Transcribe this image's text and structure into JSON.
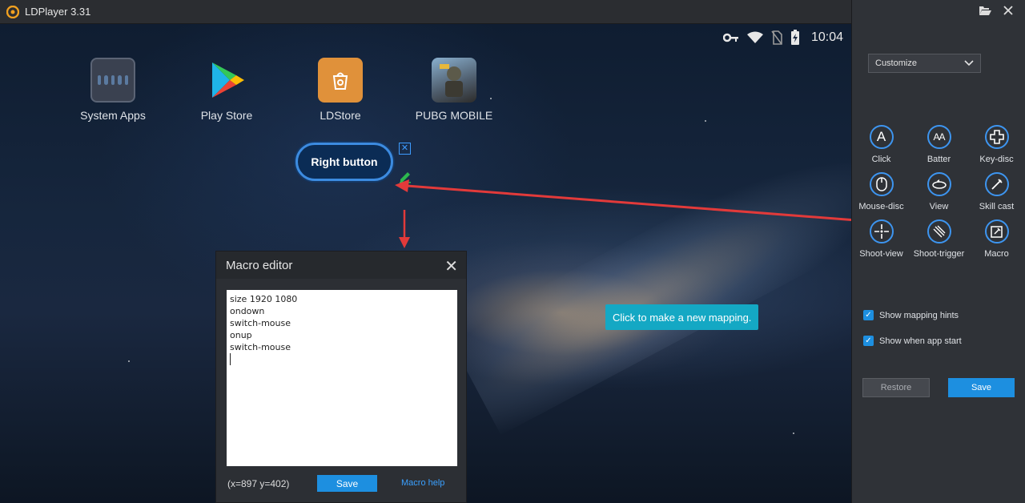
{
  "window": {
    "title": "LDPlayer 3.31"
  },
  "status": {
    "time": "10:04"
  },
  "apps": [
    {
      "label": "System Apps"
    },
    {
      "label": "Play Store"
    },
    {
      "label": "LDStore"
    },
    {
      "label": "PUBG MOBILE"
    }
  ],
  "mapping": {
    "label": "Right button"
  },
  "macro_editor": {
    "title": "Macro editor",
    "lines": [
      "size 1920 1080",
      "ondown",
      "switch-mouse",
      "onup",
      "switch-mouse"
    ],
    "coords": "(x=897  y=402)",
    "save_label": "Save",
    "help_label": "Macro help"
  },
  "tooltip": "Click to make a new mapping.",
  "sidebar": {
    "mode": "Customize",
    "tools": [
      {
        "label": "Click",
        "icon": "click-icon"
      },
      {
        "label": "Batter",
        "icon": "batter-icon"
      },
      {
        "label": "Key-disc",
        "icon": "key-disc-icon"
      },
      {
        "label": "Mouse-disc",
        "icon": "mouse-disc-icon"
      },
      {
        "label": "View",
        "icon": "view-icon"
      },
      {
        "label": "Skill cast",
        "icon": "skill-cast-icon"
      },
      {
        "label": "Shoot-view",
        "icon": "shoot-view-icon"
      },
      {
        "label": "Shoot-trigger",
        "icon": "shoot-trigger-icon"
      },
      {
        "label": "Macro",
        "icon": "macro-icon"
      }
    ],
    "options": [
      {
        "label": "Show mapping hints",
        "checked": true
      },
      {
        "label": "Show when app start",
        "checked": true
      }
    ],
    "restore_label": "Restore",
    "save_label": "Save"
  },
  "colors": {
    "accent": "#1d8fe0",
    "arrow": "#e23a3a",
    "tooltip": "#14a8c4"
  }
}
